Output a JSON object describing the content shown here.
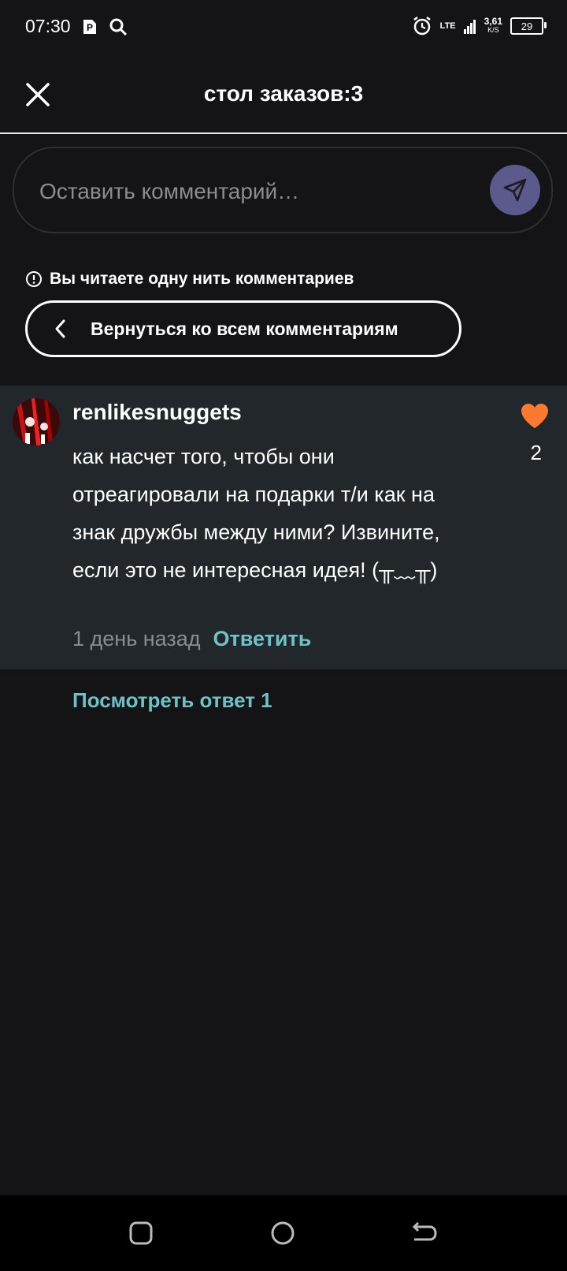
{
  "status_bar": {
    "time": "07:30",
    "network": "LTE",
    "speed": "3,61",
    "speed_unit": "K/S",
    "battery": "29",
    "icons": [
      "parking-app-icon",
      "search-icon",
      "alarm-icon",
      "signal-icon",
      "battery-icon"
    ]
  },
  "header": {
    "title": "стол заказов:3",
    "close_icon": "close-icon"
  },
  "comment_input": {
    "placeholder": "Оставить комментарий…",
    "send_icon": "send-icon",
    "send_color": "#5c5a8c"
  },
  "thread": {
    "notice": "Вы читаете одну нить комментариев",
    "back_label": "Вернуться ко всем комментариям"
  },
  "comment": {
    "username": "renlikesnuggets",
    "text": "как насчет того, чтобы они отреагировали на подарки т/и как на знак дружбы между ними? Извините, если это не интересная идея! (╥﹏╥)",
    "time": "1 день назад",
    "reply_label": "Ответить",
    "likes": "2",
    "like_color": "#ff7a2e"
  },
  "view_replies": "Посмотреть ответ 1",
  "colors": {
    "background": "#141416",
    "comment_bg": "#21272a",
    "accent": "#6ec2c6"
  },
  "nav_bar": {
    "icons": [
      "recent-apps-icon",
      "home-icon",
      "back-icon"
    ]
  }
}
